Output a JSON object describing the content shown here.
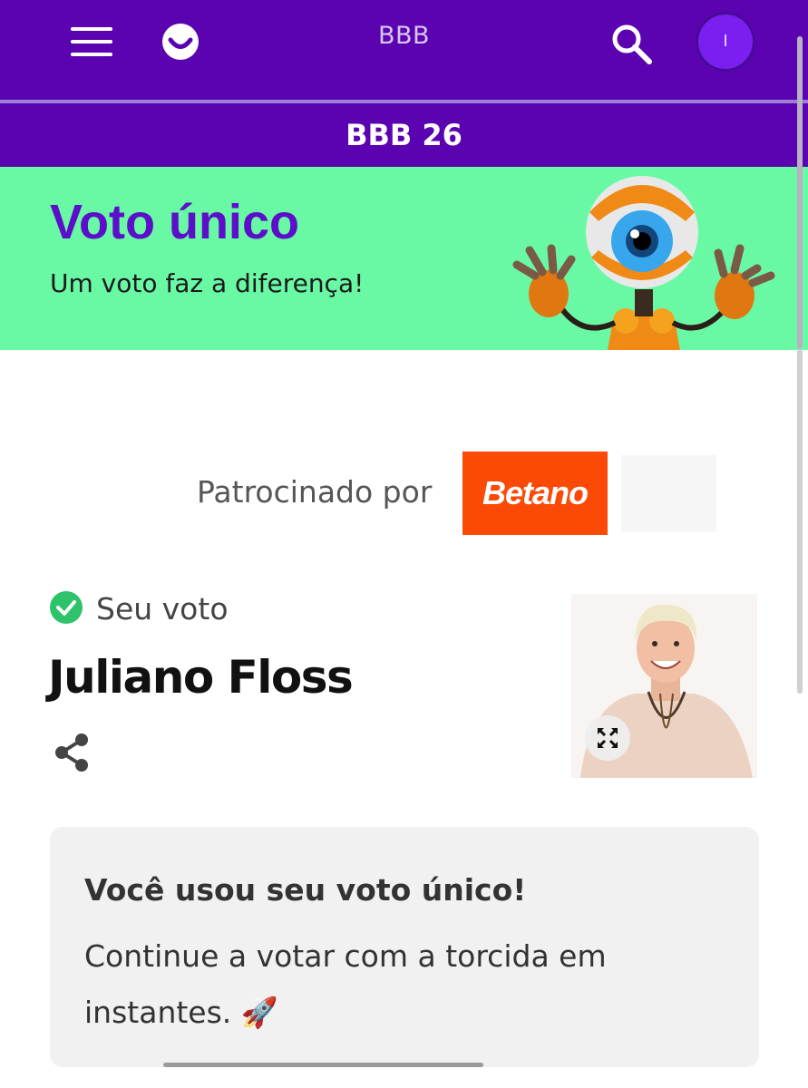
{
  "header": {
    "title": "BBB",
    "avatar_initial": "I",
    "icons": {
      "menu": "menu-icon",
      "logo": "smile-logo-icon",
      "search": "search-icon"
    }
  },
  "subheader": {
    "title": "BBB 26"
  },
  "banner": {
    "title": "Voto único",
    "subtitle": "Um voto faz a diferença!",
    "mascot": "big-eye-mascot"
  },
  "sponsor": {
    "label": "Patrocinado por",
    "brand": "Betano",
    "brand_color": "#fb4a06"
  },
  "vote": {
    "status_label": "Seu voto",
    "candidate": "Juliano Floss",
    "icons": {
      "status": "check-circle-icon",
      "share": "share-icon",
      "expand": "expand-icon"
    }
  },
  "message": {
    "title": "Você usou seu voto único!",
    "text": "Continue a votar com a torcida em instantes. 🚀"
  },
  "colors": {
    "primary": "#5b03b1",
    "banner_bg": "#69f9a5",
    "banner_title": "#5b0fc9",
    "check": "#2ec26a"
  }
}
